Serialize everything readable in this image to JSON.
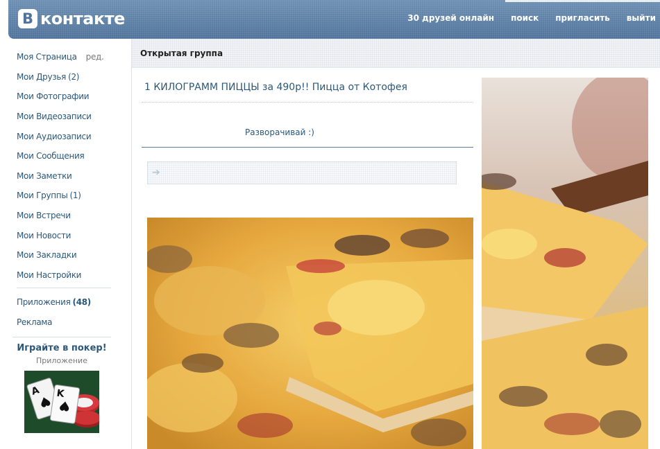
{
  "header": {
    "logo_letter": "В",
    "logo_text": "контакте",
    "nav": [
      "30 друзей онлайн",
      "поиск",
      "пригласить",
      "выйти"
    ]
  },
  "sidebar": {
    "my_page": "Моя Страница",
    "edit": "ред.",
    "items": [
      {
        "label": "Мои Друзья",
        "count": "(2)"
      },
      {
        "label": "Мои Фотографии",
        "count": ""
      },
      {
        "label": "Мои Видеозаписи",
        "count": ""
      },
      {
        "label": "Мои Аудиозаписи",
        "count": ""
      },
      {
        "label": "Мои Сообщения",
        "count": ""
      },
      {
        "label": "Мои Заметки",
        "count": ""
      },
      {
        "label": "Мои Группы",
        "count": "(1)"
      },
      {
        "label": "Мои Встречи",
        "count": ""
      },
      {
        "label": "Мои Новости",
        "count": ""
      },
      {
        "label": "Мои Закладки",
        "count": ""
      },
      {
        "label": "Мои Настройки",
        "count": ""
      }
    ],
    "apps": {
      "label": "Приложения",
      "count": "(48)"
    },
    "ads": "Реклама"
  },
  "promo": {
    "title": "Играйте в покер!",
    "subtitle": "Приложение",
    "card1": "A",
    "card2": "K"
  },
  "content": {
    "group_type": "Открытая группа",
    "post_title": "1 КИЛОГРАММ ПИЦЦЫ за 490р!! Пицца от Котофея",
    "expand_text": "Разворачивай :)",
    "input_icon": "arrow-right-icon"
  }
}
